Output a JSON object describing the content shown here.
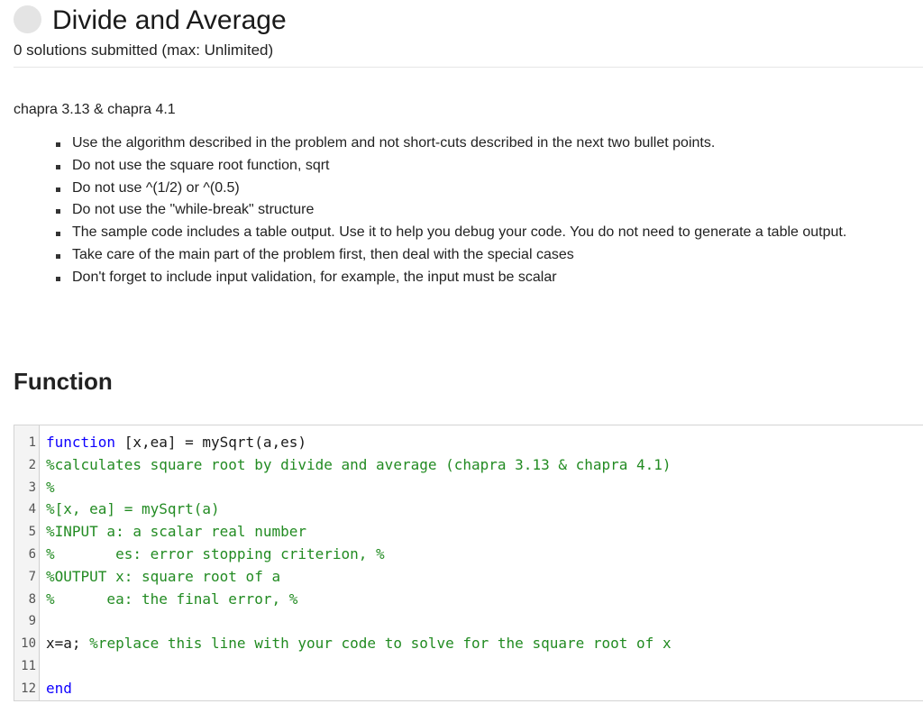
{
  "header": {
    "title": "Divide and Average",
    "submissions": "0 solutions submitted (max: Unlimited)"
  },
  "problem": {
    "reference": "chapra 3.13 & chapra 4.1",
    "rules": [
      "Use the algorithm described in the problem and not short-cuts described in the next two bullet points.",
      "Do not use the square root function, sqrt",
      "Do not use ^(1/2) or ^(0.5)",
      "Do not use the \"while-break\" structure",
      "The sample code includes a table output. Use it to help you debug your code. You do not need to generate a table output.",
      "Take care of the main part of the problem first, then deal with the special cases",
      "Don't forget to include input validation, for example, the input must be scalar"
    ]
  },
  "function_section": {
    "heading": "Function",
    "code_lines": [
      {
        "num": "1",
        "segments": [
          {
            "t": "function",
            "c": "kw"
          },
          {
            "t": " [x,ea] = mySqrt(a,es)",
            "c": "tx"
          }
        ]
      },
      {
        "num": "2",
        "segments": [
          {
            "t": "%calculates square root by divide and average (chapra 3.13 & chapra 4.1)",
            "c": "cm"
          }
        ]
      },
      {
        "num": "3",
        "segments": [
          {
            "t": "%",
            "c": "cm"
          }
        ]
      },
      {
        "num": "4",
        "segments": [
          {
            "t": "%[x, ea] = mySqrt(a)",
            "c": "cm"
          }
        ]
      },
      {
        "num": "5",
        "segments": [
          {
            "t": "%INPUT a: a scalar real number",
            "c": "cm"
          }
        ]
      },
      {
        "num": "6",
        "segments": [
          {
            "t": "%       es: error stopping criterion, %",
            "c": "cm"
          }
        ]
      },
      {
        "num": "7",
        "segments": [
          {
            "t": "%OUTPUT x: square root of a",
            "c": "cm"
          }
        ]
      },
      {
        "num": "8",
        "segments": [
          {
            "t": "%      ea: the final error, %",
            "c": "cm"
          }
        ]
      },
      {
        "num": "9",
        "segments": []
      },
      {
        "num": "10",
        "segments": [
          {
            "t": "x=a; ",
            "c": "tx"
          },
          {
            "t": "%replace this line with your code to solve for the square root of x",
            "c": "cm"
          }
        ]
      },
      {
        "num": "11",
        "segments": []
      },
      {
        "num": "12",
        "segments": [
          {
            "t": "end",
            "c": "kw"
          }
        ]
      }
    ]
  },
  "colors": {
    "keyword": "#0e00ff",
    "comment": "#228b22",
    "status_circle": "#e4e4e4"
  }
}
